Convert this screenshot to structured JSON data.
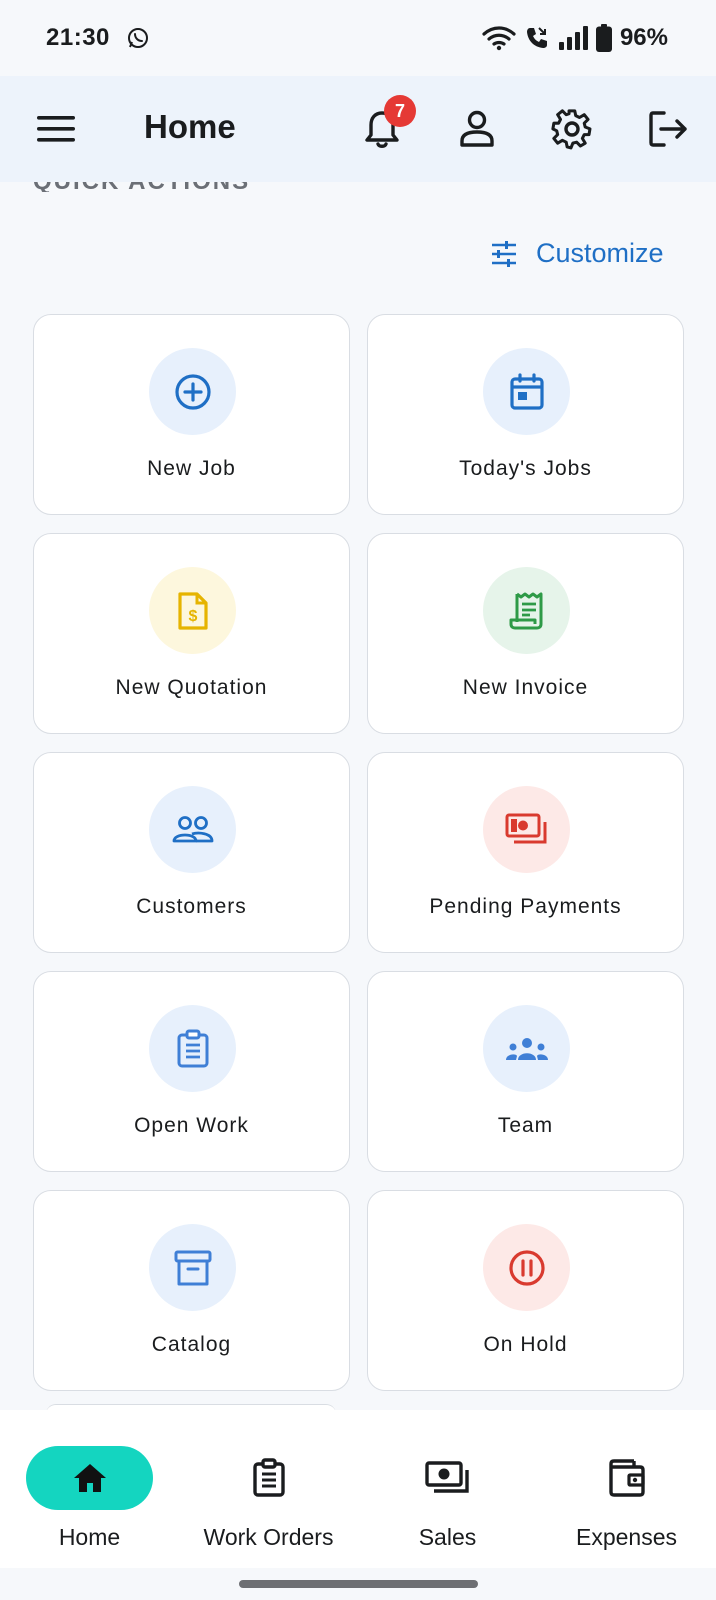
{
  "status_bar": {
    "time": "21:30",
    "battery": "96%",
    "icons": [
      "whatsapp-icon",
      "wifi-icon",
      "call-icon",
      "signal-icon",
      "battery-icon"
    ]
  },
  "app_bar": {
    "title": "Home",
    "notification_count": "7",
    "icons": [
      "menu-icon",
      "bell-icon",
      "profile-icon",
      "settings-icon",
      "logout-icon"
    ]
  },
  "quick_actions": {
    "section_label": "QUICK ACTIONS",
    "customize_label": "Customize",
    "items": [
      {
        "label": "New Job",
        "icon": "add-circle-icon",
        "color": "#1f6fc5"
      },
      {
        "label": "Today's Jobs",
        "icon": "calendar-icon",
        "color": "#1f6fc5"
      },
      {
        "label": "New Quotation",
        "icon": "quotation-icon",
        "color": "#e6b400"
      },
      {
        "label": "New Invoice",
        "icon": "invoice-icon",
        "color": "#2e9a47"
      },
      {
        "label": "Customers",
        "icon": "customers-icon",
        "color": "#1f6fc5"
      },
      {
        "label": "Pending Payments",
        "icon": "payments-icon",
        "color": "#d93a2f"
      },
      {
        "label": "Open Work",
        "icon": "clipboard-icon",
        "color": "#3f7fd6"
      },
      {
        "label": "Team",
        "icon": "team-icon",
        "color": "#3f7fd6"
      },
      {
        "label": "Catalog",
        "icon": "archive-icon",
        "color": "#3f7fd6"
      },
      {
        "label": "On Hold",
        "icon": "pause-icon",
        "color": "#d93a2f"
      }
    ]
  },
  "bottom_nav": {
    "items": [
      {
        "label": "Home",
        "icon": "home-icon",
        "active": true
      },
      {
        "label": "Work Orders",
        "icon": "work-orders-icon",
        "active": false
      },
      {
        "label": "Sales",
        "icon": "sales-icon",
        "active": false
      },
      {
        "label": "Expenses",
        "icon": "expenses-icon",
        "active": false
      }
    ],
    "active_color": "#14d5c0"
  }
}
